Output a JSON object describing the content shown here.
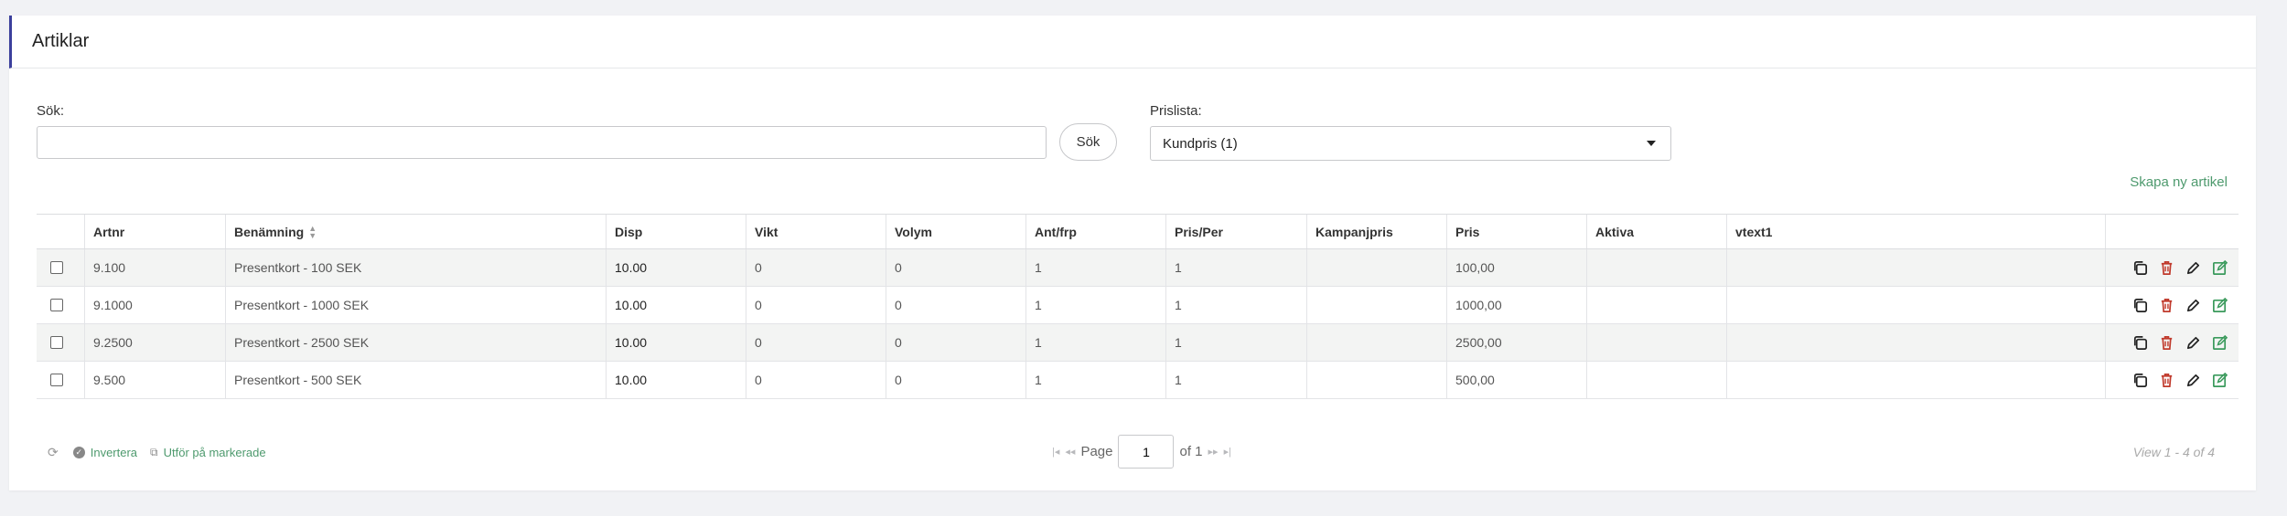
{
  "header": {
    "title": "Artiklar"
  },
  "search": {
    "label": "Sök:",
    "value": "",
    "placeholder": "",
    "button_label": "Sök"
  },
  "pricelist": {
    "label": "Prislista:",
    "selected": "Kundpris (1)"
  },
  "create_link": "Skapa ny artikel",
  "table": {
    "columns": [
      "Artnr",
      "Benämning",
      "Disp",
      "Vikt",
      "Volym",
      "Ant/frp",
      "Pris/Per",
      "Kampanjpris",
      "Pris",
      "Aktiva",
      "vtext1"
    ],
    "rows": [
      [
        "9.100",
        "Presentkort - 100 SEK",
        "10.00",
        "0",
        "0",
        "1",
        "1",
        "",
        "100,00",
        "",
        ""
      ],
      [
        "9.1000",
        "Presentkort - 1000 SEK",
        "10.00",
        "0",
        "0",
        "1",
        "1",
        "",
        "1000,00",
        "",
        ""
      ],
      [
        "9.2500",
        "Presentkort - 2500 SEK",
        "10.00",
        "0",
        "0",
        "1",
        "1",
        "",
        "2500,00",
        "",
        ""
      ],
      [
        "9.500",
        "Presentkort - 500 SEK",
        "10.00",
        "0",
        "0",
        "1",
        "1",
        "",
        "500,00",
        "",
        ""
      ]
    ]
  },
  "footer": {
    "invert_label": "Invertera",
    "apply_label": "Utför på markerade",
    "page_label": "Page",
    "page_value": "1",
    "of_label": "of 1",
    "view_info": "View 1 - 4 of 4"
  },
  "colors": {
    "accent": "#3b3f9c",
    "link": "#4e9a6e",
    "delete": "#c0392b",
    "edit_green": "#3a9a5c"
  }
}
